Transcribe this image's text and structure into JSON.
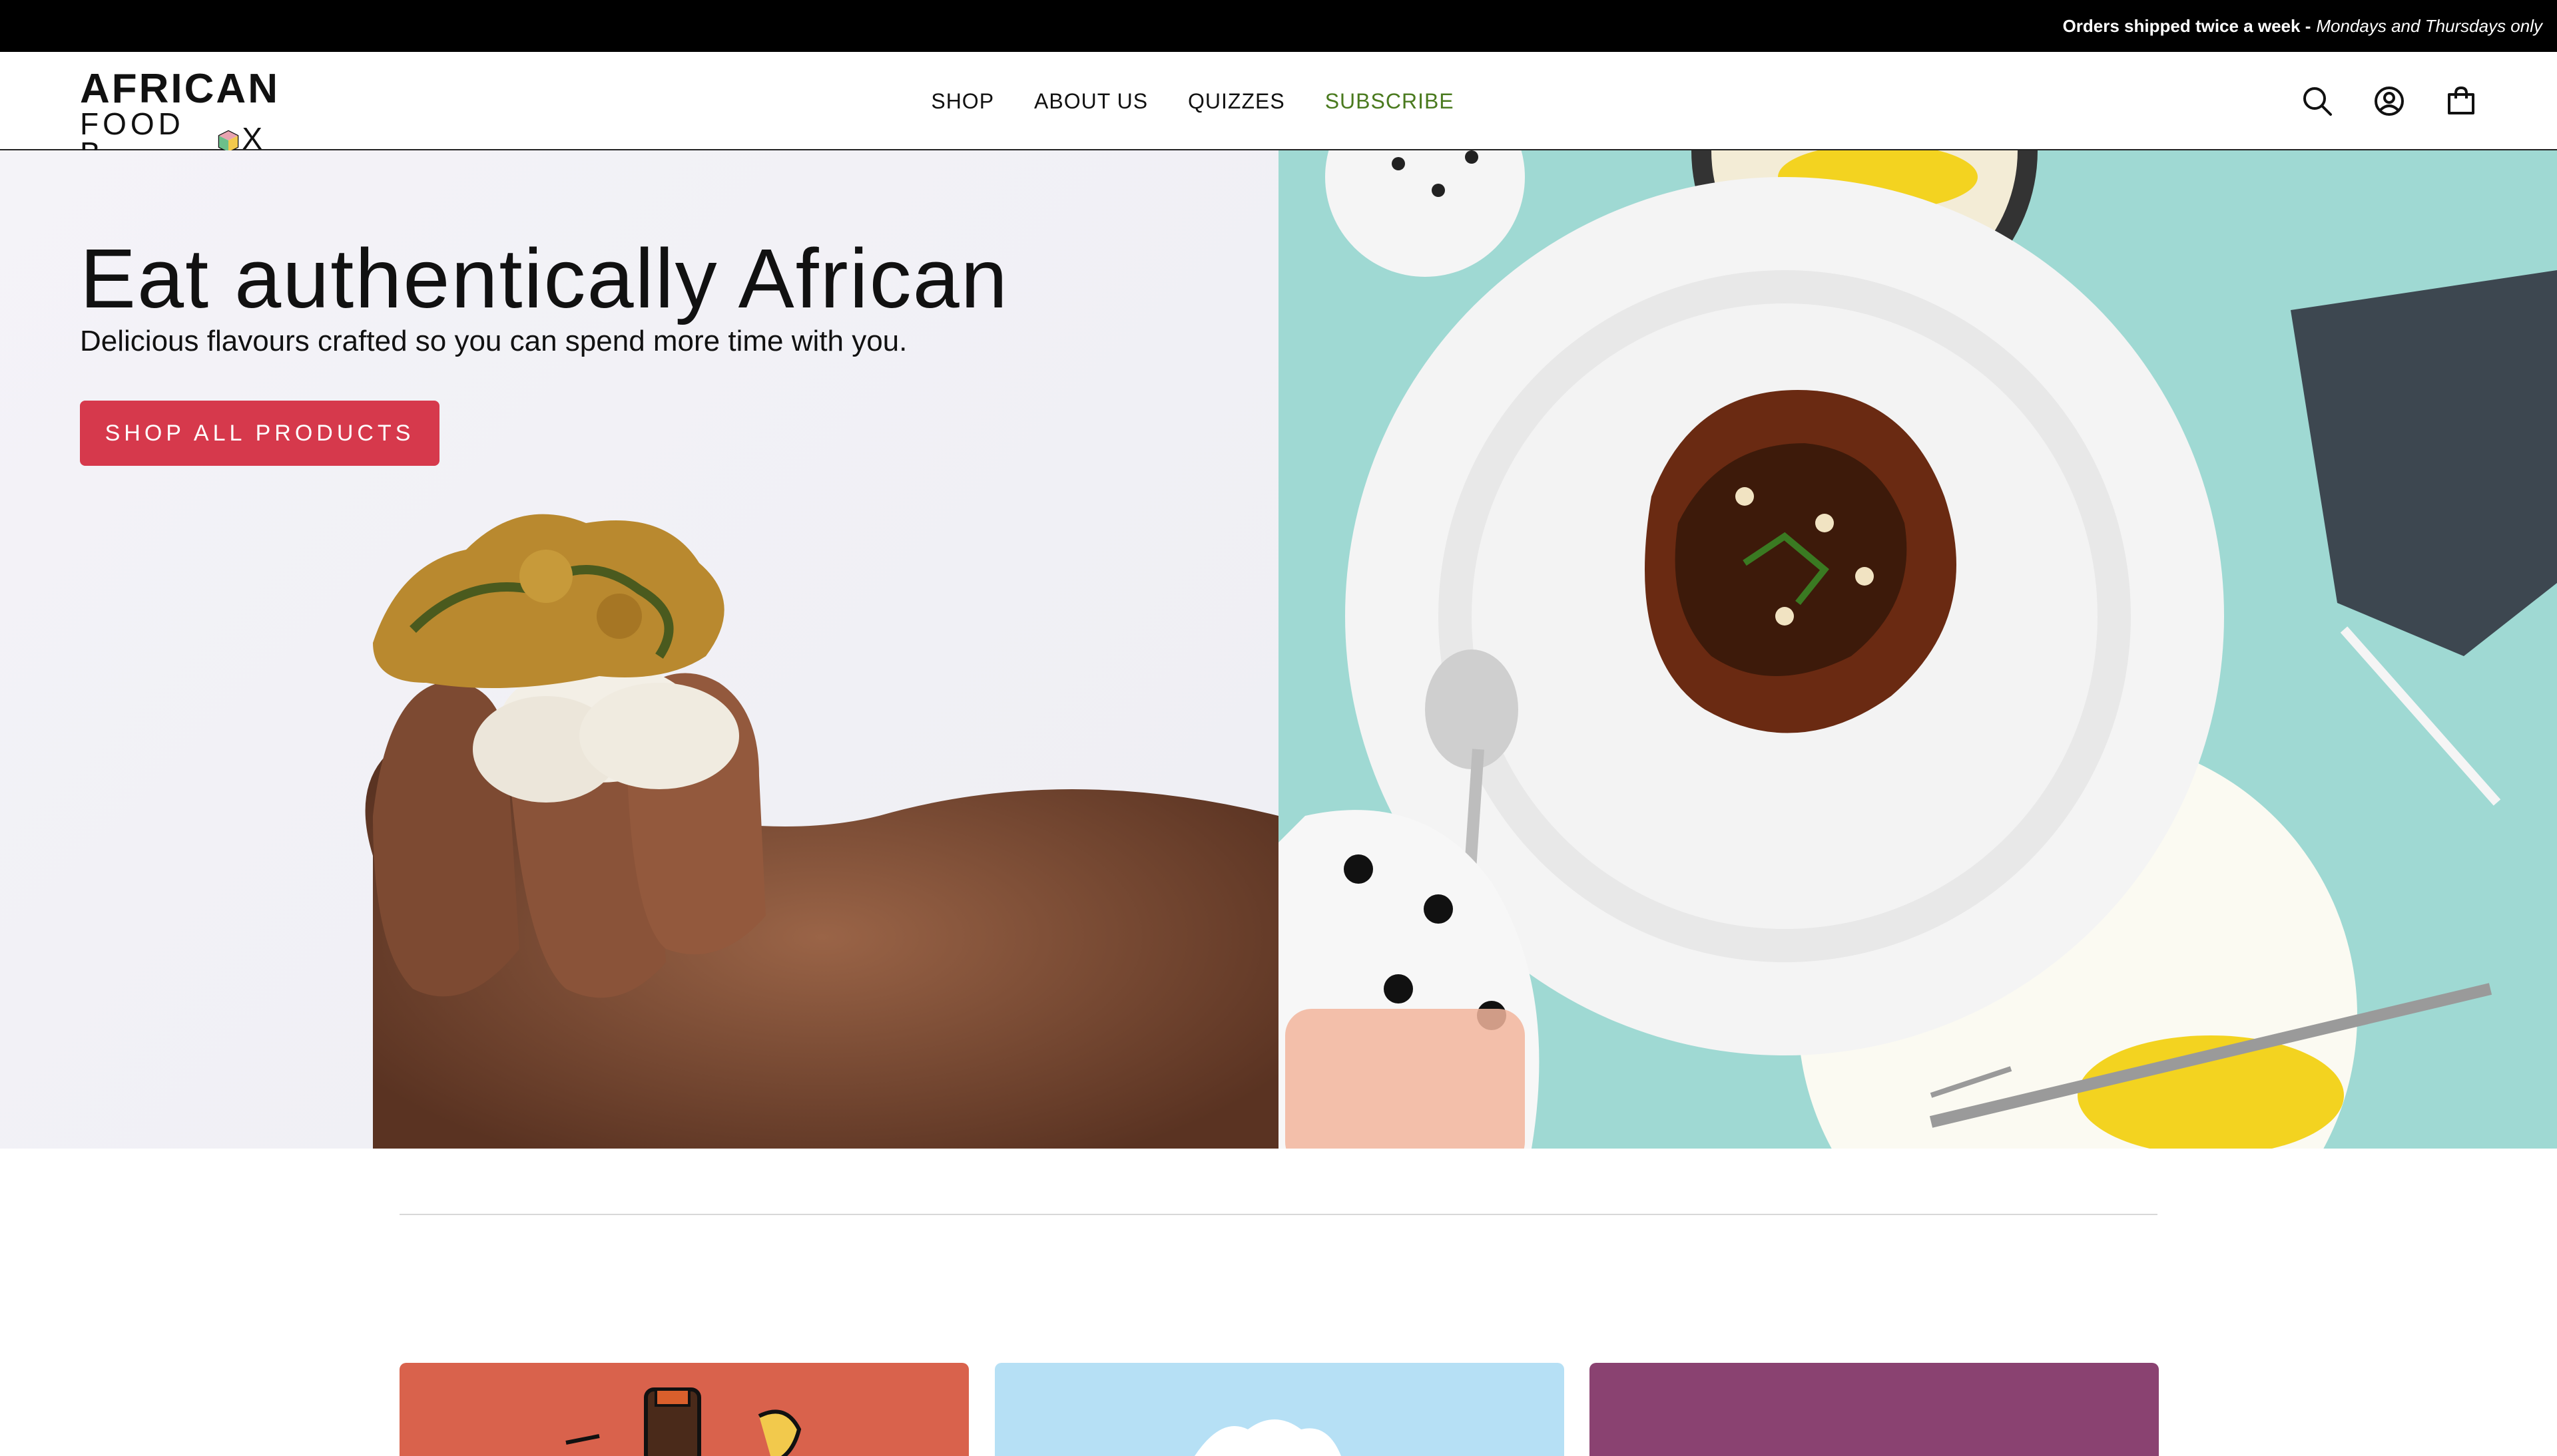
{
  "announcement": {
    "strong": "Orders shipped twice a week -",
    "em": "Mondays and Thursdays only"
  },
  "header": {
    "logo_line1": "AFRICAN",
    "logo_line2a": "FOOD B",
    "logo_line2b": "X",
    "nav": {
      "shop": "SHOP",
      "about": "ABOUT US",
      "quizzes": "QUIZZES",
      "subscribe": "SUBSCRIBE"
    }
  },
  "hero": {
    "title": "Eat authentically African",
    "subtitle": "Delicious flavours crafted so you can spend more time with you.",
    "cta": "SHOP ALL PRODUCTS"
  },
  "colors": {
    "accent": "#d6394c",
    "subscribe": "#4a7a1e",
    "announcement_bg": "#000000",
    "card1": "#d9624c",
    "card2": "#b6e0f5",
    "card3": "#8a4271"
  },
  "icons": [
    "search-icon",
    "account-icon",
    "cart-icon",
    "logo-box-icon"
  ]
}
